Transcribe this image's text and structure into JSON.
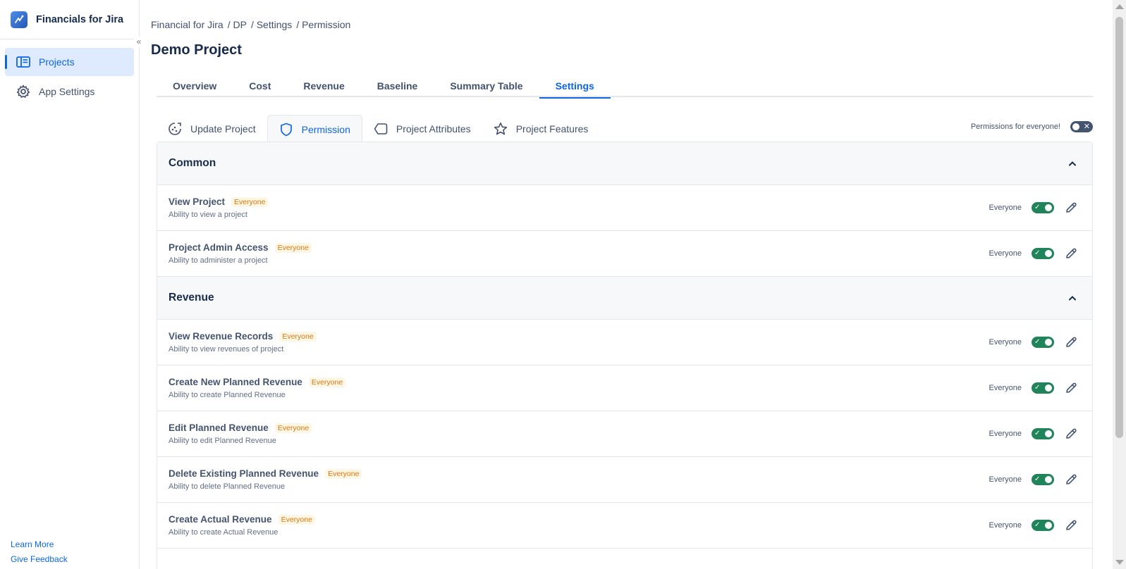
{
  "app": {
    "title": "Financials for Jira"
  },
  "sidebar": {
    "items": [
      {
        "label": "Projects",
        "icon": "projects-icon",
        "active": true
      },
      {
        "label": "App Settings",
        "icon": "gear-icon",
        "active": false
      }
    ],
    "links": {
      "learn_more": "Learn More",
      "give_feedback": "Give Feedback"
    }
  },
  "breadcrumb": [
    "Financial for Jira",
    "/ DP",
    "/ Settings",
    "/ Permission"
  ],
  "page": {
    "title": "Demo Project"
  },
  "tabs": [
    "Overview",
    "Cost",
    "Revenue",
    "Baseline",
    "Summary Table",
    "Settings"
  ],
  "active_tab": "Settings",
  "subtabs": [
    {
      "label": "Update Project",
      "icon": "update-project-icon"
    },
    {
      "label": "Permission",
      "icon": "shield-icon"
    },
    {
      "label": "Project Attributes",
      "icon": "tag-icon"
    },
    {
      "label": "Project Features",
      "icon": "star-icon"
    }
  ],
  "active_subtab": "Permission",
  "global_permission": {
    "label": "Permissions for everyone!",
    "enabled": false
  },
  "sections": [
    {
      "title": "Common",
      "rows": [
        {
          "name": "View Project",
          "badge": "Everyone",
          "desc": "Ability to view a project",
          "who": "Everyone",
          "enabled": true
        },
        {
          "name": "Project Admin Access",
          "badge": "Everyone",
          "desc": "Ability to administer a project",
          "who": "Everyone",
          "enabled": true
        }
      ]
    },
    {
      "title": "Revenue",
      "rows": [
        {
          "name": "View Revenue Records",
          "badge": "Everyone",
          "desc": "Ability to view revenues of project",
          "who": "Everyone",
          "enabled": true
        },
        {
          "name": "Create New Planned Revenue",
          "badge": "Everyone",
          "desc": "Ability to create Planned Revenue",
          "who": "Everyone",
          "enabled": true
        },
        {
          "name": "Edit Planned Revenue",
          "badge": "Everyone",
          "desc": "Ability to edit Planned Revenue",
          "who": "Everyone",
          "enabled": true
        },
        {
          "name": "Delete Existing Planned Revenue",
          "badge": "Everyone",
          "desc": "Ability to delete Planned Revenue",
          "who": "Everyone",
          "enabled": true
        },
        {
          "name": "Create Actual Revenue",
          "badge": "Everyone",
          "desc": "Ability to create Actual Revenue",
          "who": "Everyone",
          "enabled": true
        }
      ]
    }
  ],
  "colors": {
    "accent": "#0c66e4",
    "toggle_on": "#1f845a",
    "badge_text": "#e2740b"
  }
}
